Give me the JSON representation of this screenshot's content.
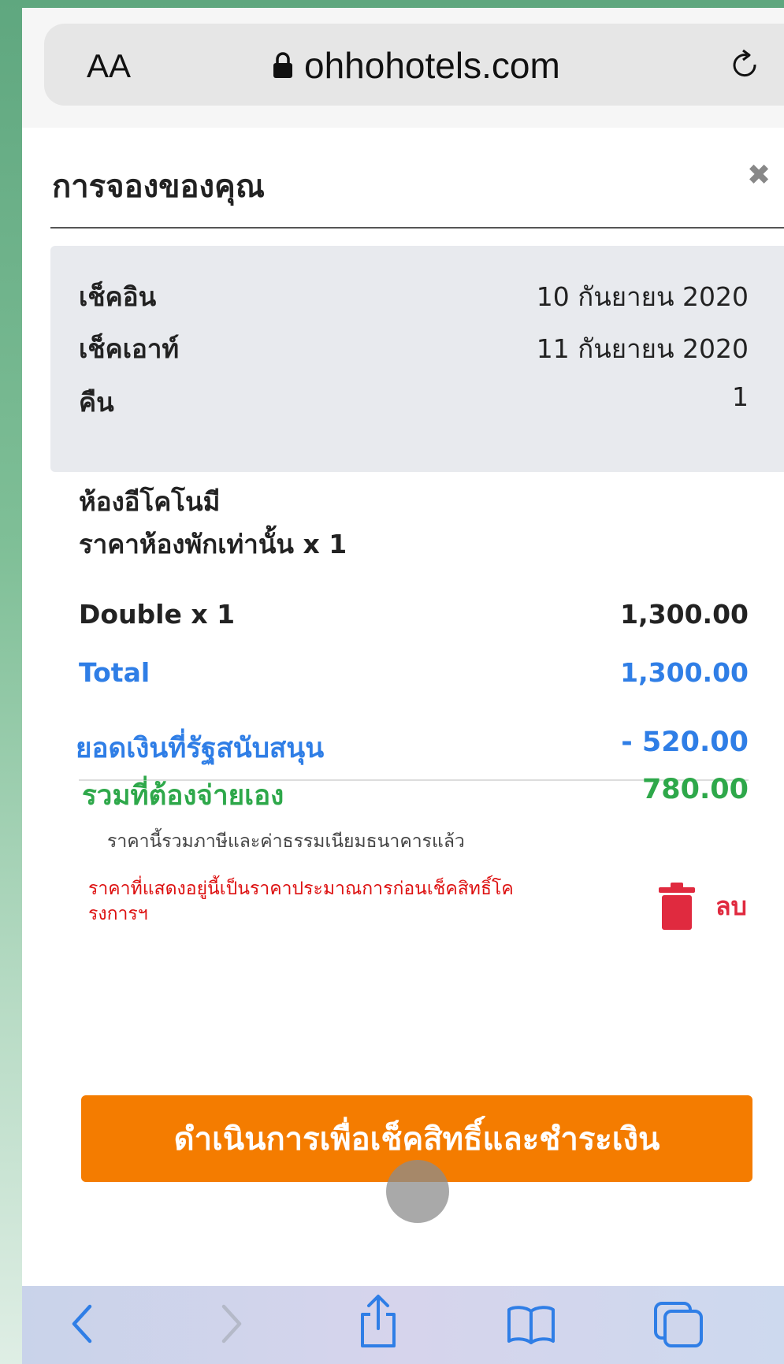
{
  "browser": {
    "text_size_label": "AA",
    "url": "ohhohotels.com"
  },
  "booking": {
    "title": "การจองของคุณ",
    "check_in_label": "เช็คอิน",
    "check_in_value": "10 กันยายน 2020",
    "check_out_label": "เช็คเอาท์",
    "check_out_value": "11 กันยายน 2020",
    "nights_label": "คืน",
    "nights_value": "1",
    "room_name": "ห้องอีโคโนมี",
    "room_rate": "ราคาห้องพักเท่านั้น x 1",
    "line_item_label": "Double x 1",
    "line_item_value": "1,300.00",
    "total_label": "Total",
    "total_value": "1,300.00",
    "subsidy_label": "ยอดเงินที่รัฐสนับสนุน",
    "subsidy_value": "- 520.00",
    "pay_label": "รวมที่ต้องจ่ายเอง",
    "pay_value": "780.00",
    "tax_note": "ราคานี้รวมภาษีและค่าธรรมเนียมธนาคารแล้ว",
    "estimate_warning": "ราคาที่แสดงอยู่นี้เป็นราคาประมาณการก่อนเช็คสิทธิ์โครงการฯ",
    "delete_label": "ลบ",
    "proceed_button": "ดำเนินการเพื่อเช็คสิทธิ์และชำระเงิน"
  },
  "colors": {
    "accent_blue": "#2f7ee6",
    "accent_green": "#2ea84a",
    "cta_orange": "#f47c00",
    "delete_red": "#e02a3f"
  }
}
